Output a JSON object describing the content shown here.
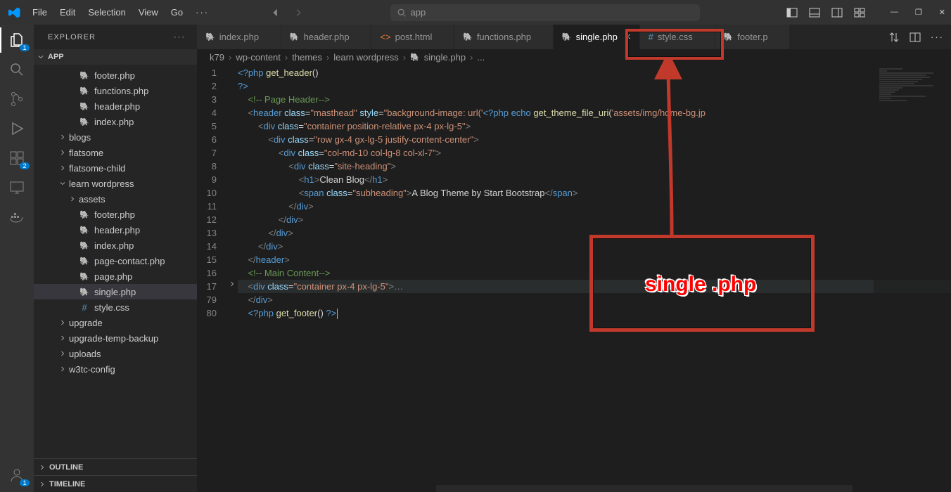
{
  "menubar": {
    "file": "File",
    "edit": "Edit",
    "selection": "Selection",
    "view": "View",
    "go": "Go",
    "more": "···"
  },
  "search": {
    "text": "app"
  },
  "activity": {
    "explorer_badge": "1",
    "extensions_badge": "2",
    "accounts_badge": "1"
  },
  "sidebar": {
    "title": "EXPLORER",
    "folder": "APP",
    "tree": [
      {
        "type": "file",
        "name": "footer.php",
        "ftype": "php",
        "indent": 3
      },
      {
        "type": "file",
        "name": "functions.php",
        "ftype": "php",
        "indent": 3
      },
      {
        "type": "file",
        "name": "header.php",
        "ftype": "php",
        "indent": 3
      },
      {
        "type": "file",
        "name": "index.php",
        "ftype": "php",
        "indent": 3
      },
      {
        "type": "folder",
        "name": "blogs",
        "state": "closed",
        "indent": 2
      },
      {
        "type": "folder",
        "name": "flatsome",
        "state": "closed",
        "indent": 2
      },
      {
        "type": "folder",
        "name": "flatsome-child",
        "state": "closed",
        "indent": 2
      },
      {
        "type": "folder",
        "name": "learn wordpress",
        "state": "open",
        "indent": 2
      },
      {
        "type": "folder",
        "name": "assets",
        "state": "closed",
        "indent": 3
      },
      {
        "type": "file",
        "name": "footer.php",
        "ftype": "php",
        "indent": 3
      },
      {
        "type": "file",
        "name": "header.php",
        "ftype": "php",
        "indent": 3
      },
      {
        "type": "file",
        "name": "index.php",
        "ftype": "php",
        "indent": 3
      },
      {
        "type": "file",
        "name": "page-contact.php",
        "ftype": "php",
        "indent": 3
      },
      {
        "type": "file",
        "name": "page.php",
        "ftype": "php",
        "indent": 3
      },
      {
        "type": "file",
        "name": "single.php",
        "ftype": "php",
        "indent": 3,
        "selected": true
      },
      {
        "type": "file",
        "name": "style.css",
        "ftype": "css",
        "indent": 3
      },
      {
        "type": "folder",
        "name": "upgrade",
        "state": "closed",
        "indent": 2
      },
      {
        "type": "folder",
        "name": "upgrade-temp-backup",
        "state": "closed",
        "indent": 2
      },
      {
        "type": "folder",
        "name": "uploads",
        "state": "closed",
        "indent": 2
      },
      {
        "type": "folder",
        "name": "w3tc-config",
        "state": "closed",
        "indent": 2
      }
    ],
    "outline": "OUTLINE",
    "timeline": "TIMELINE"
  },
  "tabs": [
    {
      "label": "index.php",
      "ftype": "php"
    },
    {
      "label": "header.php",
      "ftype": "php"
    },
    {
      "label": "post.html",
      "ftype": "html"
    },
    {
      "label": "functions.php",
      "ftype": "php"
    },
    {
      "label": "single.php",
      "ftype": "php",
      "active": true
    },
    {
      "label": "style.css",
      "ftype": "css"
    },
    {
      "label": "footer.p",
      "ftype": "php",
      "truncated": true
    }
  ],
  "breadcrumb": [
    "k79",
    "wp-content",
    "themes",
    "learn wordpress",
    "single.php",
    "..."
  ],
  "code": {
    "lines": [
      {
        "n": 1,
        "html": "<span class='c-php'>&lt;?php</span> <span class='c-fn'>get_header</span>()"
      },
      {
        "n": 2,
        "html": "<span class='c-php'>?&gt;</span>"
      },
      {
        "n": 3,
        "html": "    <span class='c-cmt'>&lt;!-- Page Header--&gt;</span>"
      },
      {
        "n": 4,
        "html": "    <span class='c-pct'>&lt;</span><span class='c-tag'>header</span> <span class='c-attr'>class</span>=<span class='c-str'>\"masthead\"</span> <span class='c-attr'>style</span>=<span class='c-str'>\"background-image: url('</span><span class='c-php'>&lt;?php</span> <span class='c-kw'>echo</span> <span class='c-fn'>get_theme_file_uri</span>(<span class='c-str'>'assets/img/home-bg.jp</span>"
      },
      {
        "n": 5,
        "html": "        <span class='c-pct'>&lt;</span><span class='c-tag'>div</span> <span class='c-attr'>class</span>=<span class='c-str'>\"container position-relative px-4 px-lg-5\"</span><span class='c-pct'>&gt;</span>"
      },
      {
        "n": 6,
        "html": "            <span class='c-pct'>&lt;</span><span class='c-tag'>div</span> <span class='c-attr'>class</span>=<span class='c-str'>\"row gx-4 gx-lg-5 justify-content-center\"</span><span class='c-pct'>&gt;</span>"
      },
      {
        "n": 7,
        "html": "                <span class='c-pct'>&lt;</span><span class='c-tag'>div</span> <span class='c-attr'>class</span>=<span class='c-str'>\"col-md-10 col-lg-8 col-xl-7\"</span><span class='c-pct'>&gt;</span>"
      },
      {
        "n": 8,
        "html": "                    <span class='c-pct'>&lt;</span><span class='c-tag'>div</span> <span class='c-attr'>class</span>=<span class='c-str'>\"site-heading\"</span><span class='c-pct'>&gt;</span>"
      },
      {
        "n": 9,
        "html": "                        <span class='c-pct'>&lt;</span><span class='c-tag'>h1</span><span class='c-pct'>&gt;</span>Clean Blog<span class='c-pct'>&lt;/</span><span class='c-tag'>h1</span><span class='c-pct'>&gt;</span>"
      },
      {
        "n": 10,
        "html": "                        <span class='c-pct'>&lt;</span><span class='c-tag'>span</span> <span class='c-attr'>class</span>=<span class='c-str'>\"subheading\"</span><span class='c-pct'>&gt;</span>A Blog Theme by Start Bootstrap<span class='c-pct'>&lt;/</span><span class='c-tag'>span</span><span class='c-pct'>&gt;</span>"
      },
      {
        "n": 11,
        "html": "                    <span class='c-pct'>&lt;/</span><span class='c-tag'>div</span><span class='c-pct'>&gt;</span>"
      },
      {
        "n": 12,
        "html": "                <span class='c-pct'>&lt;/</span><span class='c-tag'>div</span><span class='c-pct'>&gt;</span>"
      },
      {
        "n": 13,
        "html": "            <span class='c-pct'>&lt;/</span><span class='c-tag'>div</span><span class='c-pct'>&gt;</span>"
      },
      {
        "n": 14,
        "html": "        <span class='c-pct'>&lt;/</span><span class='c-tag'>div</span><span class='c-pct'>&gt;</span>"
      },
      {
        "n": 15,
        "html": "    <span class='c-pct'>&lt;/</span><span class='c-tag'>header</span><span class='c-pct'>&gt;</span>"
      },
      {
        "n": 16,
        "html": "    <span class='c-cmt'>&lt;!-- Main Content--&gt;</span>"
      },
      {
        "n": 17,
        "html": "    <span class='c-pct'>&lt;</span><span class='c-tag'>div</span> <span class='c-attr'>class</span>=<span class='c-str'>\"container px-4 px-lg-5\"</span><span class='c-pct'>&gt;</span><span class='c-grey'>…</span>",
        "hl": true,
        "fold": true
      },
      {
        "n": 79,
        "html": "    <span class='c-pct'>&lt;/</span><span class='c-tag'>div</span><span class='c-pct'>&gt;</span>"
      },
      {
        "n": 80,
        "html": "    <span class='c-php'>&lt;?php</span> <span class='c-fn'>get_footer</span>() <span class='c-php'>?&gt;</span>",
        "cursor": true
      }
    ]
  },
  "annot": {
    "label": "single .php"
  }
}
